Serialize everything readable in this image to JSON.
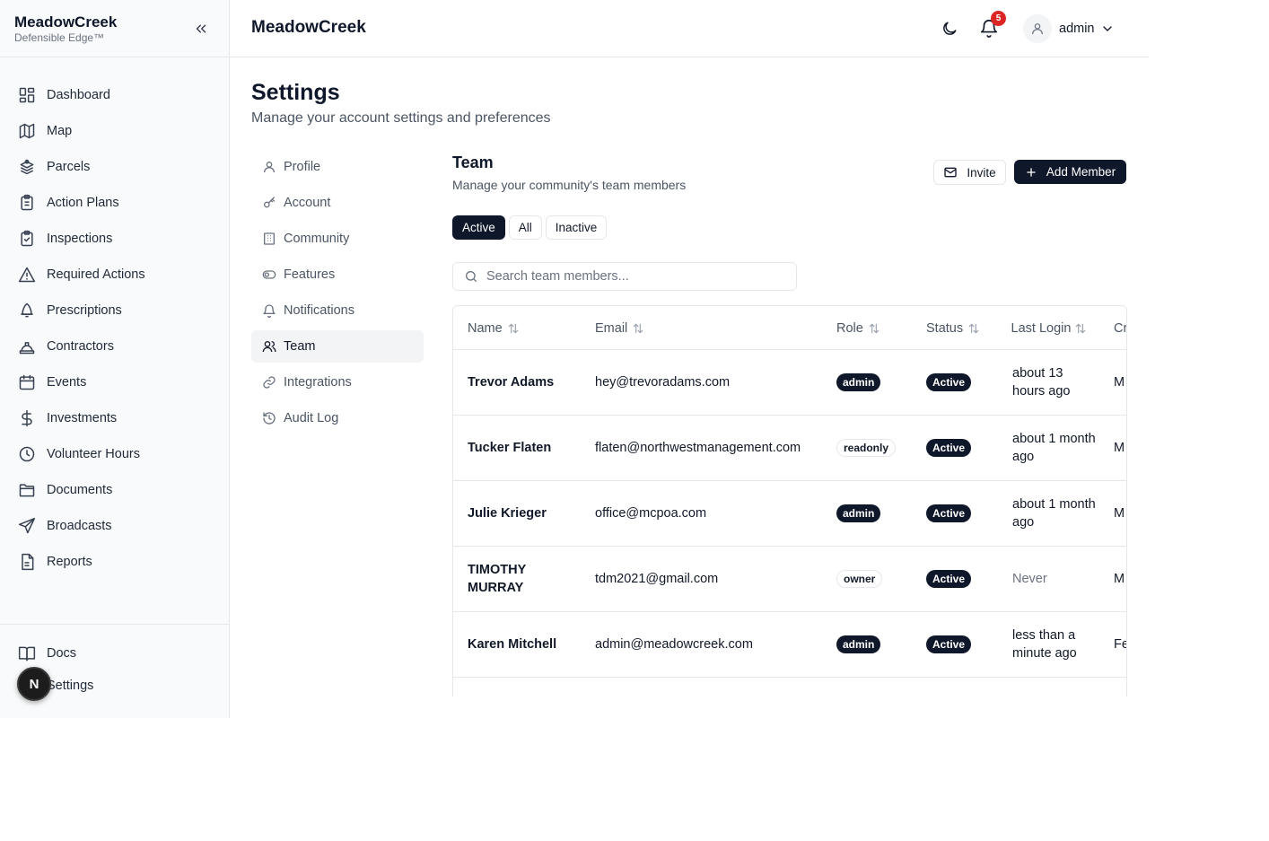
{
  "brand": {
    "name": "MeadowCreek",
    "tagline": "Defensible Edge™"
  },
  "sidebar": {
    "items": [
      {
        "label": "Dashboard",
        "icon": "dashboard-icon"
      },
      {
        "label": "Map",
        "icon": "map-icon"
      },
      {
        "label": "Parcels",
        "icon": "parcels-icon"
      },
      {
        "label": "Action Plans",
        "icon": "clipboard-icon"
      },
      {
        "label": "Inspections",
        "icon": "clipboard-check-icon"
      },
      {
        "label": "Required Actions",
        "icon": "warning-icon"
      },
      {
        "label": "Prescriptions",
        "icon": "flame-icon"
      },
      {
        "label": "Contractors",
        "icon": "hard-hat-icon"
      },
      {
        "label": "Events",
        "icon": "calendar-icon"
      },
      {
        "label": "Investments",
        "icon": "dollar-icon"
      },
      {
        "label": "Volunteer Hours",
        "icon": "clock-icon"
      },
      {
        "label": "Documents",
        "icon": "folder-icon"
      },
      {
        "label": "Broadcasts",
        "icon": "send-icon"
      },
      {
        "label": "Reports",
        "icon": "file-text-icon"
      }
    ],
    "bottom": [
      {
        "label": "Docs",
        "icon": "book-icon"
      },
      {
        "label": "Settings",
        "icon": "gear-icon"
      }
    ],
    "fab_letter": "N"
  },
  "header": {
    "title": "MeadowCreek",
    "notifications": "5",
    "user": "admin"
  },
  "page": {
    "title": "Settings",
    "subtitle": "Manage your account settings and preferences"
  },
  "settings_nav": [
    {
      "label": "Profile",
      "icon": "user-icon"
    },
    {
      "label": "Account",
      "icon": "key-icon"
    },
    {
      "label": "Community",
      "icon": "building-icon"
    },
    {
      "label": "Features",
      "icon": "toggle-icon"
    },
    {
      "label": "Notifications",
      "icon": "bell-icon"
    },
    {
      "label": "Team",
      "icon": "users-icon",
      "active": true
    },
    {
      "label": "Integrations",
      "icon": "link-icon"
    },
    {
      "label": "Audit Log",
      "icon": "history-icon"
    }
  ],
  "team": {
    "title": "Team",
    "subtitle": "Manage your community's team members",
    "invite_label": "Invite",
    "add_label": "Add Member",
    "filters": [
      "Active",
      "All",
      "Inactive"
    ],
    "active_filter": "Active",
    "search_placeholder": "Search team members...",
    "columns": [
      "Name",
      "Email",
      "Role",
      "Status",
      "Last Login",
      "Cr"
    ],
    "rows": [
      {
        "name": "Trevor Adams",
        "email": "hey@trevoradams.com",
        "role": "admin",
        "status": "Active",
        "last_login": "about 13 hours ago",
        "created": "M"
      },
      {
        "name": "Tucker Flaten",
        "email": "flaten@northwestmanagement.com",
        "role": "readonly",
        "status": "Active",
        "last_login": "about 1 month ago",
        "created": "M"
      },
      {
        "name": "Julie Krieger",
        "email": "office@mcpoa.com",
        "role": "admin",
        "status": "Active",
        "last_login": "about 1 month ago",
        "created": "M"
      },
      {
        "name": "TIMOTHY MURRAY",
        "email": "tdm2021@gmail.com",
        "role": "owner",
        "status": "Active",
        "last_login": "Never",
        "created": "M"
      },
      {
        "name": "Karen Mitchell",
        "email": "admin@meadowcreek.com",
        "role": "admin",
        "status": "Active",
        "last_login": "less than a minute ago",
        "created": "Fe"
      }
    ]
  },
  "colors": {
    "primary": "#0f172a",
    "badge": "#dc2626",
    "border": "#e5e7eb",
    "muted": "#6b7280"
  }
}
